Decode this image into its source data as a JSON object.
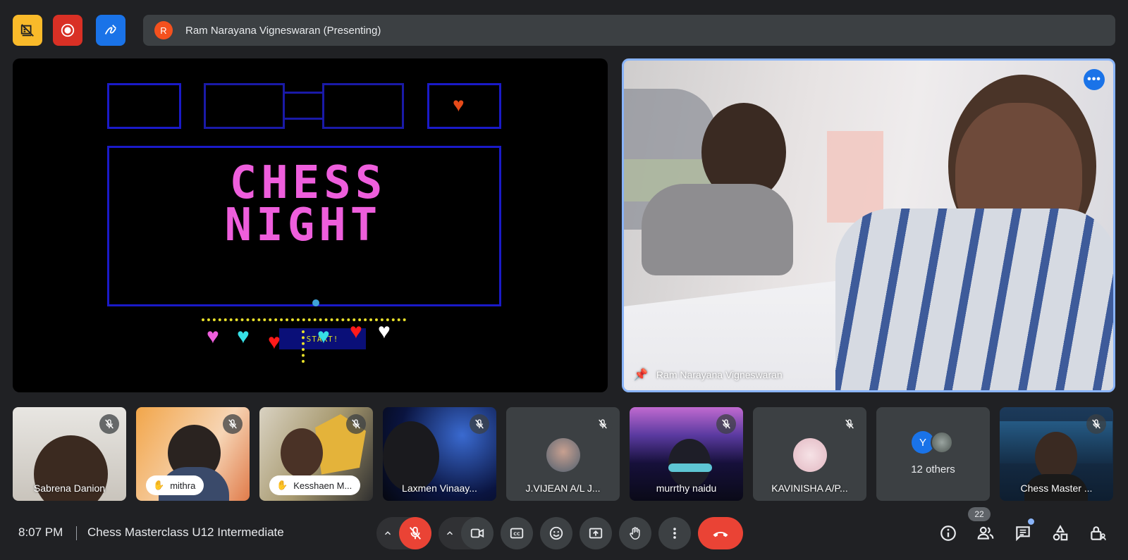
{
  "presenter": {
    "initial": "R",
    "label": "Ram Narayana Vigneswaran (Presenting)"
  },
  "slide": {
    "title_line1": "CHESS",
    "title_line2": "NIGHT",
    "start_label": "START!"
  },
  "camera": {
    "name": "Ram Narayana Vigneswaran"
  },
  "participants": [
    {
      "name": "Sabrena Danion"
    },
    {
      "name": "mithra"
    },
    {
      "name": "Kesshaen M..."
    },
    {
      "name": "Laxmen Vinaay..."
    },
    {
      "name": "J.VIJEAN A/L J..."
    },
    {
      "name": "murrthy naidu"
    },
    {
      "name": "KAVINISHA A/P..."
    },
    {
      "name": "12 others",
      "initial": "Y"
    },
    {
      "name": "Chess Master ..."
    }
  ],
  "bottom": {
    "time": "8:07 PM",
    "meeting_title": "Chess Masterclass U12 Intermediate",
    "people_count": "22"
  },
  "colors": {
    "background": "#202124",
    "end_call": "#ea4335",
    "accent": "#8ab4f8",
    "slide_title": "#ee5edc"
  }
}
